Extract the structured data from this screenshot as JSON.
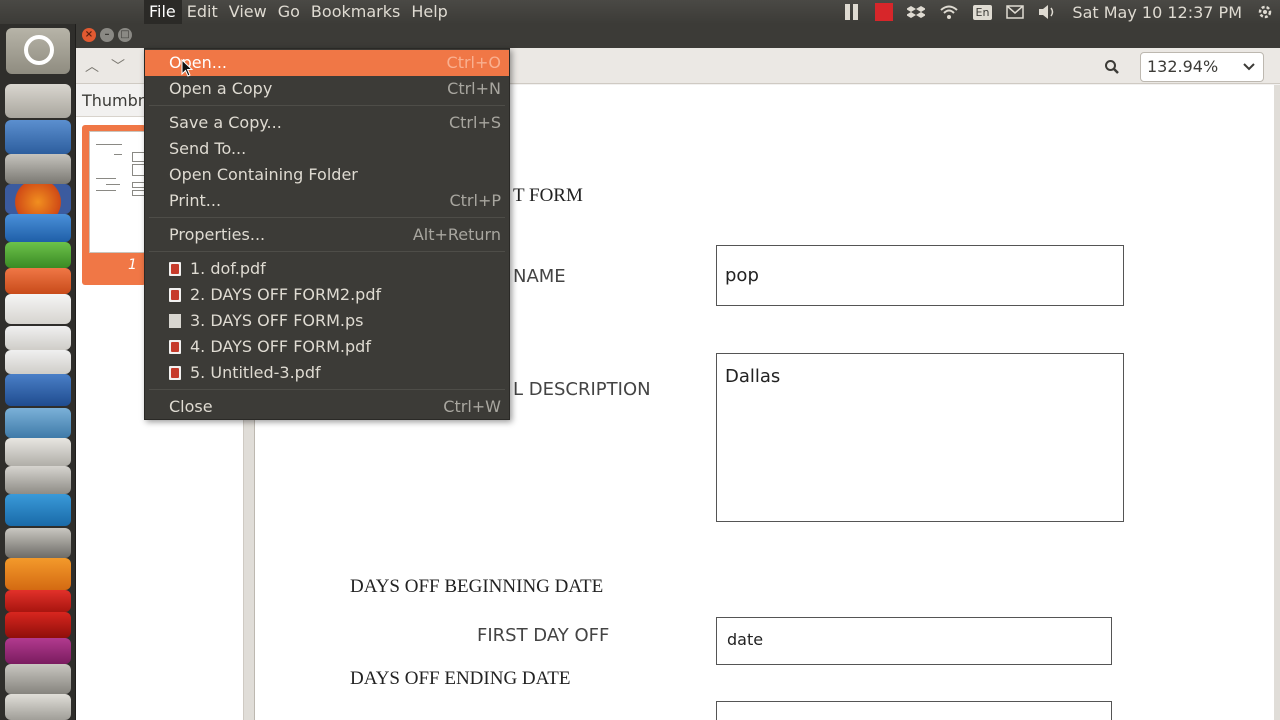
{
  "menubar": {
    "items": [
      "File",
      "Edit",
      "View",
      "Go",
      "Bookmarks",
      "Help"
    ]
  },
  "indicators": {
    "keyboard": "En",
    "clock": "Sat May 10 12:37 PM"
  },
  "toolbar": {
    "zoom": "132.94%"
  },
  "sidebar": {
    "header": "Thumbn",
    "page_number": "1"
  },
  "file_menu": {
    "items": [
      {
        "label": "Open...",
        "accel": "Ctrl+O"
      },
      {
        "label": "Open a Copy",
        "accel": "Ctrl+N"
      },
      {
        "label": "Save a Copy...",
        "accel": "Ctrl+S"
      },
      {
        "label": "Send To...",
        "accel": ""
      },
      {
        "label": "Open Containing Folder",
        "accel": ""
      },
      {
        "label": "Print...",
        "accel": "Ctrl+P"
      },
      {
        "label": "Properties...",
        "accel": "Alt+Return"
      }
    ],
    "recent": [
      {
        "label": "1. dof.pdf",
        "type": "pdf"
      },
      {
        "label": "2. DAYS OFF FORM2.pdf",
        "type": "pdf"
      },
      {
        "label": "3. DAYS OFF FORM.ps",
        "type": "ps"
      },
      {
        "label": "4. DAYS OFF FORM.pdf",
        "type": "pdf"
      },
      {
        "label": "5. Untitled-3.pdf",
        "type": "pdf"
      }
    ],
    "close": {
      "label": "Close",
      "accel": "Ctrl+W"
    }
  },
  "document": {
    "title_fragment": "T FORM",
    "name_label": "NAME",
    "desc_label": "L DESCRIPTION",
    "name_value": "pop",
    "desc_value": "Dallas",
    "begin_heading": "DAYS OFF BEGINNING DATE",
    "first_day_label": "FIRST DAY OFF",
    "first_day_value": "date",
    "end_heading": "DAYS OFF ENDING DATE"
  }
}
